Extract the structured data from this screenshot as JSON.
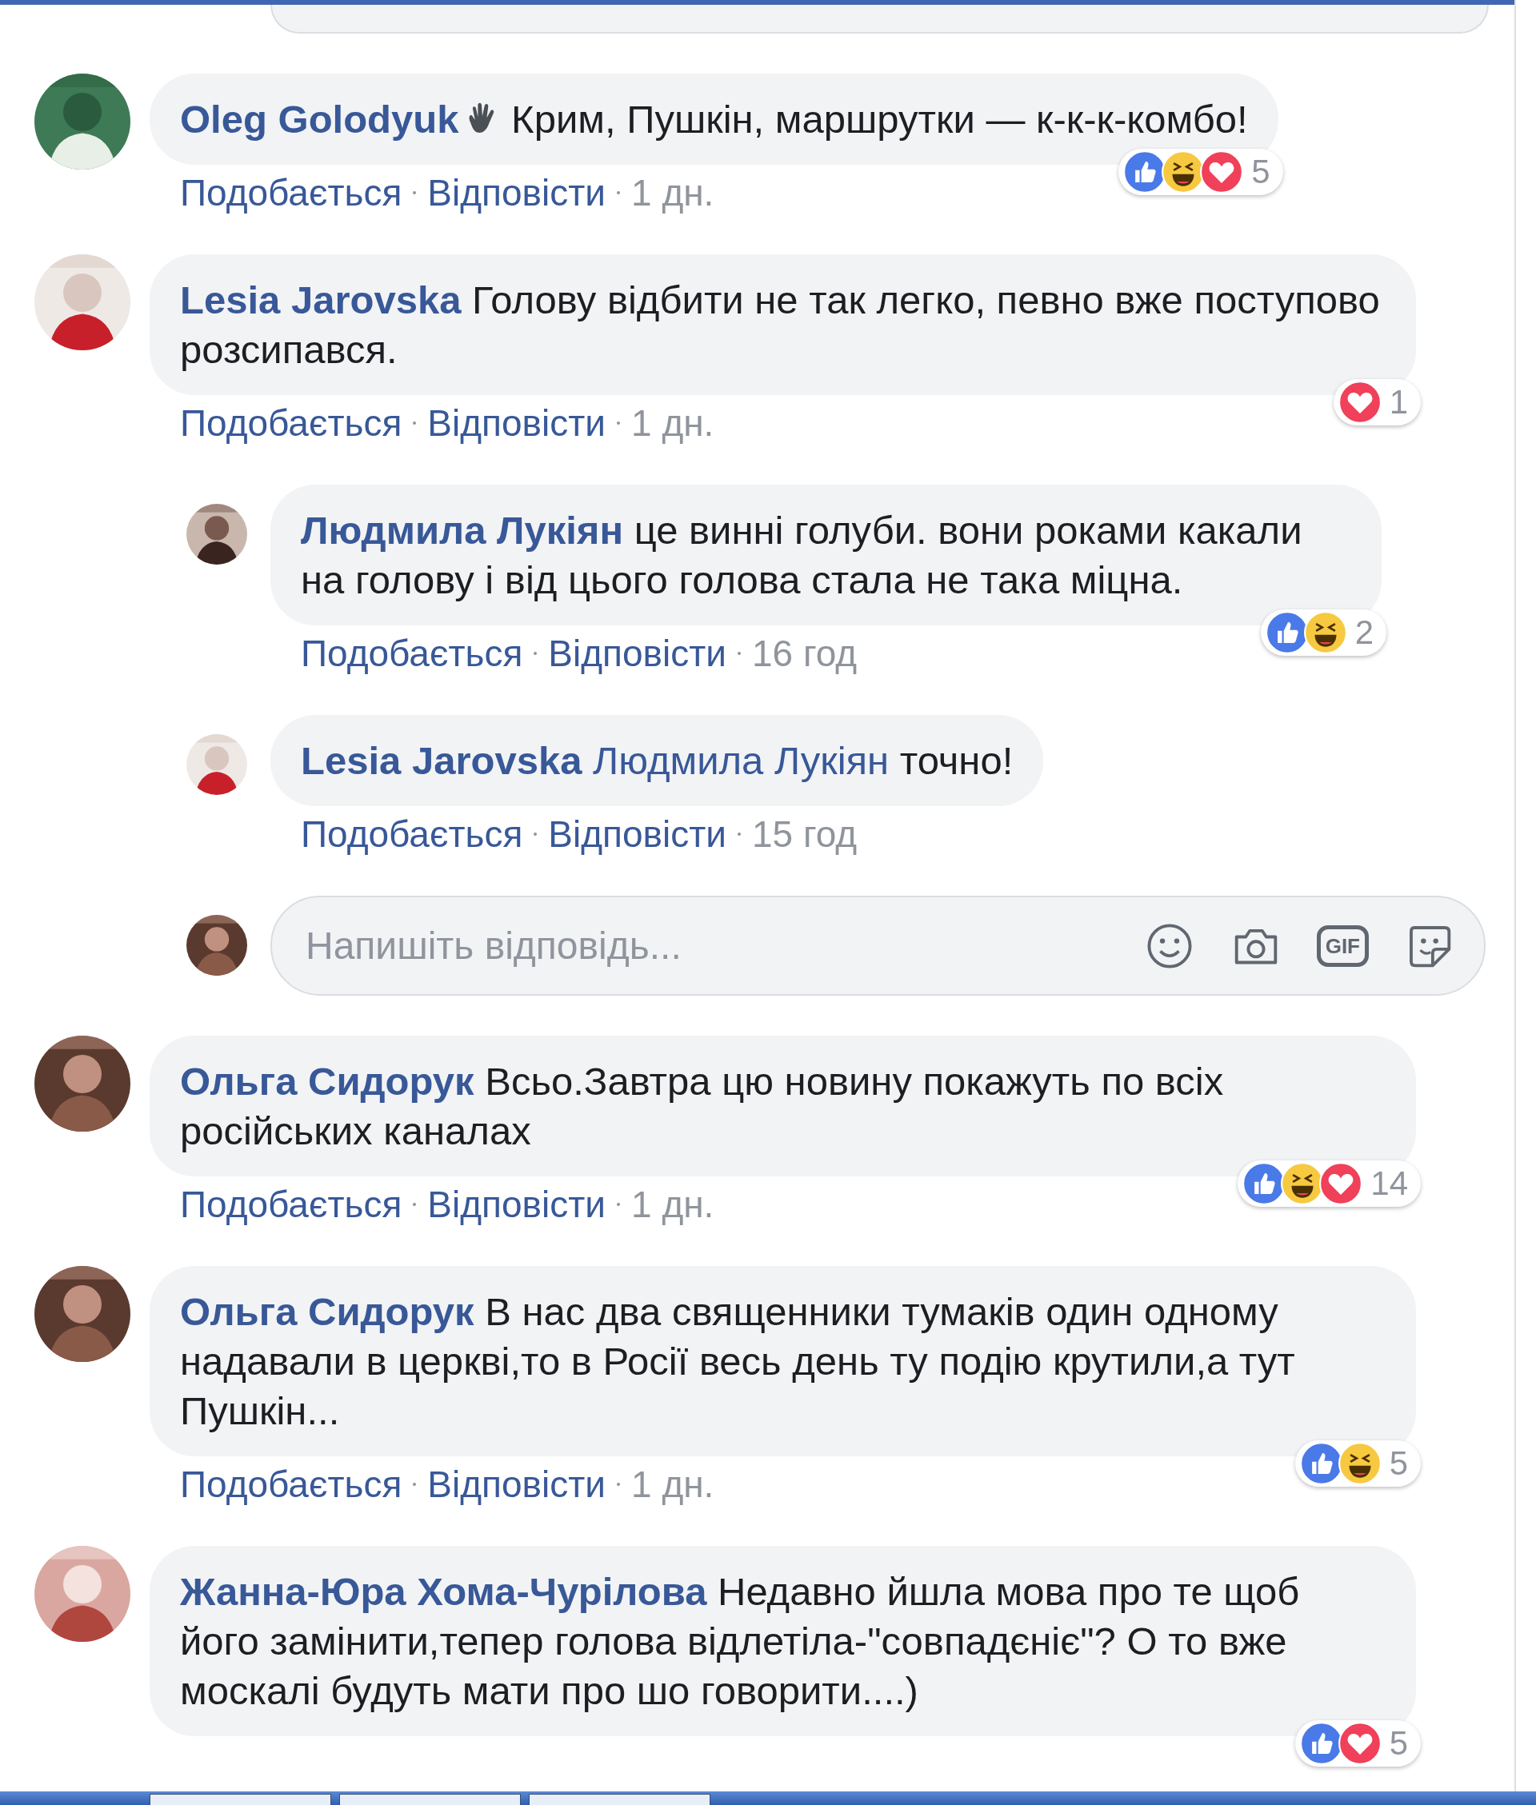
{
  "top_reply_field": {
    "kind": "partial"
  },
  "comments": [
    {
      "kind": "comment",
      "author": "Oleg Golodyuk",
      "has_badge": true,
      "text": "Крим, Пушкін, маршрутки — к-к-к-комбо!",
      "like": "Подобається",
      "reply": "Відповісти",
      "time": "1 дн.",
      "reactions": [
        {
          "kind": "like"
        },
        {
          "kind": "haha"
        },
        {
          "kind": "love"
        }
      ],
      "count": "5"
    },
    {
      "kind": "comment",
      "author": "Lesia Jarovska",
      "has_badge": false,
      "text": "Голову відбити не так легко, певно вже поступово розсипався.",
      "like": "Подобається",
      "reply": "Відповісти",
      "time": "1 дн.",
      "reactions": [
        {
          "kind": "love"
        }
      ],
      "count": "1"
    },
    {
      "kind": "reply",
      "author": "Людмила Лукіян",
      "has_badge": false,
      "text": "це винні голуби. вони роками какали на голову і від цього голова стала не така міцна.",
      "like": "Подобається",
      "reply": "Відповісти",
      "time": "16 год",
      "reactions": [
        {
          "kind": "like"
        },
        {
          "kind": "haha"
        }
      ],
      "count": "2"
    },
    {
      "kind": "reply",
      "author": "Lesia Jarovska",
      "has_badge": false,
      "mention": "Людмила Лукіян",
      "text": "точно!",
      "like": "Подобається",
      "reply": "Відповісти",
      "time": "15 год"
    },
    {
      "kind": "composer",
      "placeholder": "Напишіть відповідь...",
      "icons": [
        {
          "kind": "emoji"
        },
        {
          "kind": "camera"
        },
        {
          "kind": "gif",
          "label": "GIF"
        },
        {
          "kind": "sticker"
        }
      ]
    },
    {
      "kind": "comment",
      "author": "Ольга Сидорук",
      "has_badge": false,
      "text": "Всьо.Завтра цю новину покажуть по всіх російських каналах",
      "like": "Подобається",
      "reply": "Відповісти",
      "time": "1 дн.",
      "reactions": [
        {
          "kind": "like"
        },
        {
          "kind": "haha"
        },
        {
          "kind": "love"
        }
      ],
      "count": "14"
    },
    {
      "kind": "comment",
      "author": "Ольга Сидорук",
      "has_badge": false,
      "text": "В нас два священники тумаків один одному надавали в церкві,то в Росії весь день ту подію крутили,а тут Пушкін...",
      "like": "Подобається",
      "reply": "Відповісти",
      "time": "1 дн.",
      "reactions": [
        {
          "kind": "like"
        },
        {
          "kind": "haha"
        }
      ],
      "count": "5"
    },
    {
      "kind": "comment",
      "author": "Жанна-Юра Хома-Чурілова",
      "has_badge": false,
      "text": "Недавно йшла мова про те щоб його замінити,тепер голова відлетіла-\"совпадєніє\"? О то вже москалі будуть мати про шо говорити....)",
      "reactions": [
        {
          "kind": "like"
        },
        {
          "kind": "love"
        }
      ],
      "count": "5"
    }
  ],
  "taskbar": {
    "tabs": [
      {
        "kind": "tab"
      },
      {
        "kind": "tab"
      },
      {
        "kind": "tab"
      }
    ]
  }
}
